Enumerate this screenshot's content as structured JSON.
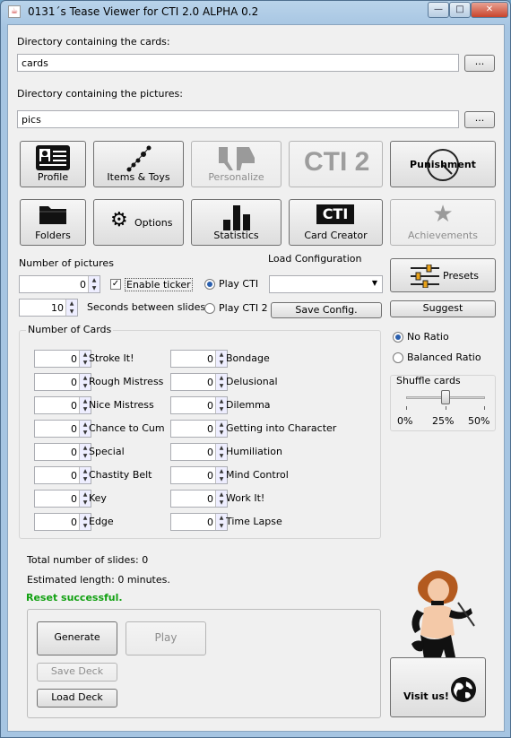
{
  "window": {
    "title": "0131´s Tease Viewer for CTI 2.0 ALPHA 0.2",
    "minimize": "—",
    "maximize": "□",
    "close": "✕"
  },
  "paths": {
    "cards_label": "Directory containing the cards:",
    "cards_value": "cards",
    "pictures_label": "Directory containing the pictures:",
    "pictures_value": "pics",
    "browse_label": "..."
  },
  "toolbar": {
    "profile": "Profile",
    "items_toys": "Items & Toys",
    "personalize": "Personalize",
    "cti2_logo": "CTI 2",
    "punishment": "Punishment",
    "folders": "Folders",
    "options": "Options",
    "statistics": "Statistics",
    "cti_logo": "CTI",
    "card_creator": "Card Creator",
    "achievements": "Achievements"
  },
  "settings": {
    "num_pictures_label": "Number of pictures",
    "num_pictures_value": "0",
    "enable_ticker": "Enable ticker",
    "enable_ticker_checked": true,
    "seconds_value": "10",
    "seconds_label": "Seconds between slides",
    "play_cti": "Play CTI",
    "play_cti2": "Play CTI 2",
    "load_config_label": "Load Configuration",
    "load_config_value": "",
    "save_config": "Save Config.",
    "presets": "Presets",
    "suggest": "Suggest"
  },
  "cards": {
    "group_title": "Number of Cards",
    "left": [
      {
        "label": "Stroke It!",
        "value": "0"
      },
      {
        "label": "Rough Mistress",
        "value": "0"
      },
      {
        "label": "Nice Mistress",
        "value": "0"
      },
      {
        "label": "Chance to Cum",
        "value": "0"
      },
      {
        "label": "Special",
        "value": "0"
      },
      {
        "label": "Chastity Belt",
        "value": "0"
      },
      {
        "label": "Key",
        "value": "0"
      },
      {
        "label": "Edge",
        "value": "0"
      }
    ],
    "right": [
      {
        "label": "Bondage",
        "value": "0"
      },
      {
        "label": "Delusional",
        "value": "0"
      },
      {
        "label": "Dilemma",
        "value": "0"
      },
      {
        "label": "Getting into Character",
        "value": "0"
      },
      {
        "label": "Humiliation",
        "value": "0"
      },
      {
        "label": "Mind Control",
        "value": "0"
      },
      {
        "label": "Work It!",
        "value": "0"
      },
      {
        "label": "Time Lapse",
        "value": "0"
      }
    ]
  },
  "ratio": {
    "no_ratio": "No Ratio",
    "balanced_ratio": "Balanced Ratio",
    "shuffle_title": "Shuffle cards",
    "shuffle_value_percent": 25,
    "ticks": [
      "0%",
      "25%",
      "50%"
    ]
  },
  "summary": {
    "total_slides": "Total number of slides: 0",
    "estimated_length": "Estimated length: 0 minutes.",
    "status": "Reset successful."
  },
  "actions": {
    "generate": "Generate",
    "play": "Play",
    "save_deck": "Save Deck",
    "load_deck": "Load Deck",
    "visit_us": "Visit us!"
  },
  "colors": {
    "status_green": "#12a112",
    "radio_selected": "#2a5fae"
  }
}
